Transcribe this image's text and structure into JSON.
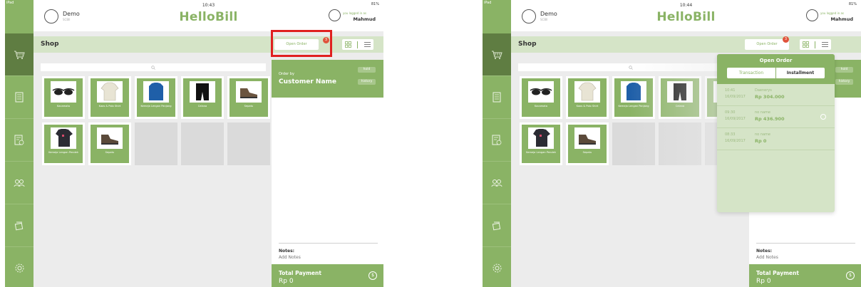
{
  "status": {
    "device": "iPad",
    "battery": "81%"
  },
  "store": {
    "name": "Demo",
    "sub": "SCBII"
  },
  "brand": "HelloBill",
  "user": {
    "sub": "you logged in as",
    "name": "Mahmud"
  },
  "shop_title": "Shop",
  "open_order": {
    "label": "Open Order",
    "badge": "3"
  },
  "colors": {
    "accent": "#8ab365",
    "dark": "#5f7d42",
    "highlight": "#e02020",
    "badge": "#e0533c"
  },
  "products": [
    {
      "label": "Kacamata",
      "kind": "glasses"
    },
    {
      "label": "Kaos & Polo Shirt",
      "kind": "polo"
    },
    {
      "label": "Kemeja Lengan Panjang",
      "kind": "shirt"
    },
    {
      "label": "Celana",
      "kind": "shorts"
    },
    {
      "label": "Sepatu",
      "kind": "shoe"
    },
    {
      "label": "Kemeja Lengan Pendek",
      "kind": "tshirt"
    },
    {
      "label": "Sepatu",
      "kind": "shoe"
    }
  ],
  "order_panel": {
    "order_by": "Order by",
    "customer": "Customer Name",
    "hold": "hold",
    "history": "history",
    "notes_label": "Notes:",
    "notes_add": "Add Notes",
    "total_label": "Total Payment",
    "total_value": "Rp 0"
  },
  "screens": [
    {
      "time": "10:43"
    },
    {
      "time": "10:44"
    }
  ],
  "popover": {
    "title": "Open Order",
    "tab_active": "Transaction",
    "tab_other": "Installment",
    "orders": [
      {
        "time": "10:41",
        "date": "16/09/2017",
        "name": "Daenerys",
        "amount": "Rp 304.000"
      },
      {
        "time": "09:30",
        "date": "16/09/2017",
        "name": "no name",
        "amount": "Rp 436.900"
      },
      {
        "time": "08:33",
        "date": "16/09/2017",
        "name": "no name",
        "amount": "Rp 0"
      }
    ]
  },
  "icons": [
    "cart-icon",
    "orders-icon",
    "receipt-icon",
    "customers-icon",
    "inventory-icon",
    "settings-icon",
    "search-icon",
    "grid-view-icon",
    "list-view-icon",
    "payment-icon",
    "register-icon",
    "user-icon"
  ]
}
